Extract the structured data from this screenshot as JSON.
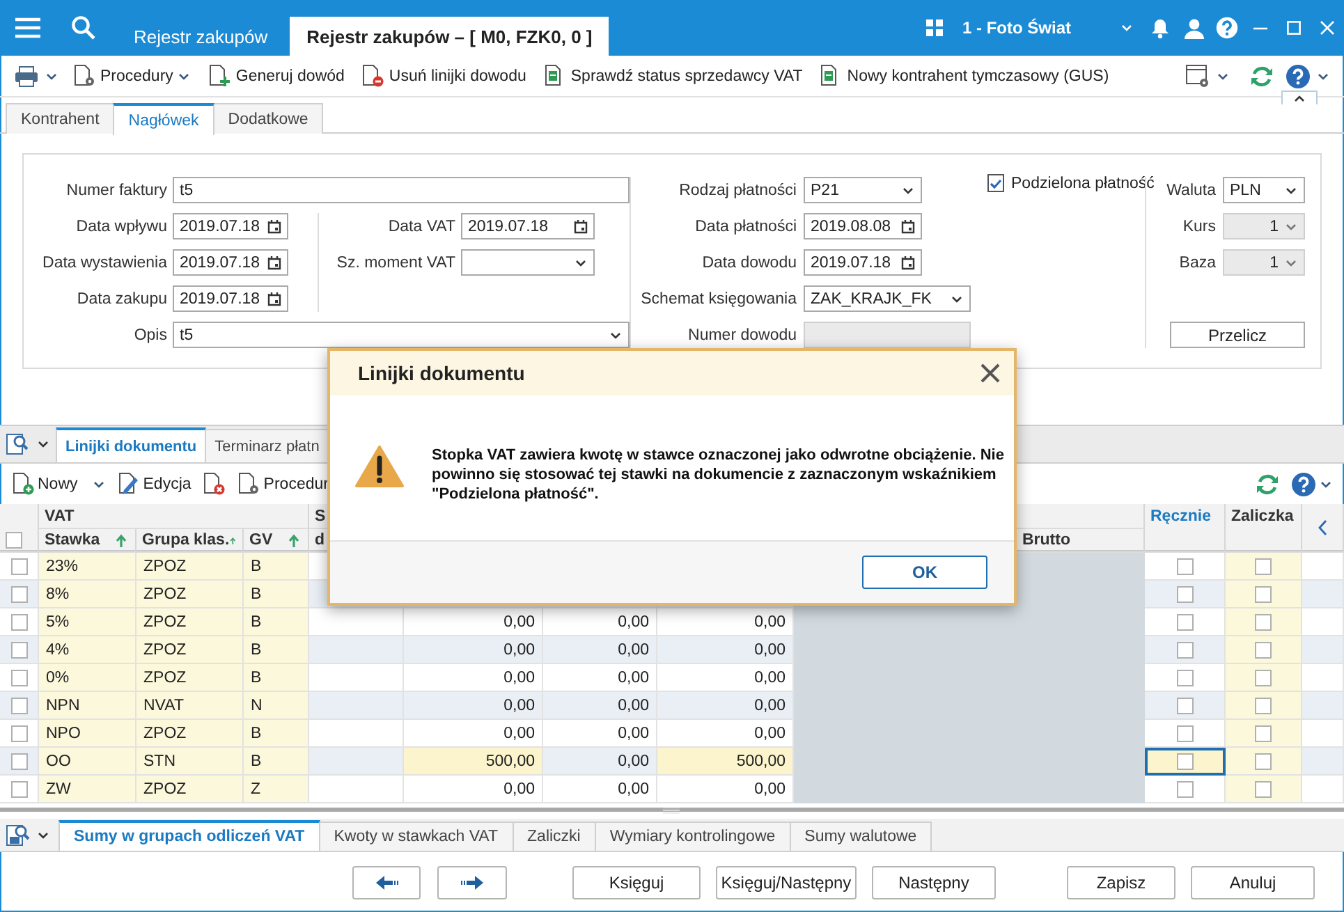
{
  "title_bar": {
    "tabs": [
      {
        "label": "Rejestr zakupów",
        "selected": false
      },
      {
        "label": "Rejestr zakupów – [ M0, FZK0, 0 ]",
        "selected": true
      }
    ],
    "company": "1 - Foto Świat"
  },
  "toolbar": {
    "items": [
      {
        "label": "Procedury",
        "dropdown": true
      },
      {
        "label": "Generuj dowód",
        "dropdown": false
      },
      {
        "label": "Usuń linijki dowodu",
        "dropdown": false
      },
      {
        "label": "Sprawdź status sprzedawcy VAT",
        "dropdown": false
      },
      {
        "label": "Nowy kontrahent tymczasowy (GUS)",
        "dropdown": false
      }
    ]
  },
  "tabs": [
    {
      "label": "Kontrahent",
      "selected": false
    },
    {
      "label": "Nagłówek",
      "selected": true
    },
    {
      "label": "Dodatkowe",
      "selected": false
    }
  ],
  "form": {
    "column_1": [
      {
        "label": "Numer faktury",
        "value": "t5",
        "kind": "text"
      },
      {
        "label": "Data wpływu",
        "value": "2019.07.18",
        "kind": "date"
      },
      {
        "label": "Data wystawienia",
        "value": "2019.07.18",
        "kind": "date"
      },
      {
        "label": "Data zakupu",
        "value": "2019.07.18",
        "kind": "date"
      },
      {
        "label": "Opis",
        "value": "t5",
        "kind": "select"
      }
    ],
    "column_1b": [
      {
        "label": "Data VAT",
        "value": "2019.07.18",
        "kind": "date"
      },
      {
        "label": "Sz. moment VAT",
        "kind": "select"
      }
    ],
    "column_2": [
      {
        "label": "Rodzaj płatności",
        "value": "P21",
        "kind": "select"
      },
      {
        "label": "Data płatności",
        "value": "2019.08.08",
        "kind": "date"
      },
      {
        "label": "Data dowodu",
        "value": "2019.07.18",
        "kind": "date"
      },
      {
        "label": "Schemat księgowania",
        "value": "ZAK_KRAJK_FK",
        "kind": "select"
      },
      {
        "label": "Numer dowodu",
        "kind": "text",
        "disabled": true
      }
    ],
    "split_payment": {
      "label": "Podzielona płatność",
      "checked": true
    },
    "column_3": [
      {
        "label": "Waluta",
        "value": "PLN",
        "kind": "select",
        "disabled": false
      },
      {
        "label": "Kurs",
        "value": "1",
        "kind": "select",
        "disabled": true
      },
      {
        "label": "Baza",
        "value": "1",
        "kind": "select",
        "disabled": true
      }
    ],
    "recalculate_button": "Przelicz"
  },
  "lines": {
    "tabs": [
      {
        "label": "Linijki dokumentu",
        "selected": true
      },
      {
        "label": "Terminarz płatn",
        "selected": false
      }
    ],
    "toolbar": [
      {
        "label": "Nowy",
        "dropdown": true
      },
      {
        "label": "Edycja",
        "dropdown": false
      },
      {
        "label": "Procedur",
        "dropdown": false
      }
    ]
  },
  "grid": {
    "group_headers": [
      "VAT",
      "S"
    ],
    "columns": [
      "Stawka",
      "Grupa klas.",
      "GV",
      "d",
      "Brutto"
    ],
    "manual_header": "Ręcznie",
    "advance_header": "Zaliczka",
    "header_checked": false,
    "rows": [
      {
        "checked": false,
        "rate": "23%",
        "group": "ZPOZ",
        "gv": "B",
        "manual": false,
        "advance": false,
        "selected": false
      },
      {
        "checked": false,
        "rate": "8%",
        "group": "ZPOZ",
        "gv": "B",
        "manual": false,
        "advance": false,
        "selected": false
      },
      {
        "checked": false,
        "rate": "5%",
        "group": "ZPOZ",
        "gv": "B",
        "amounts": [
          "0,00",
          "0,00",
          "0,00"
        ],
        "manual": false,
        "advance": false,
        "selected": false
      },
      {
        "checked": false,
        "rate": "4%",
        "group": "ZPOZ",
        "gv": "B",
        "amounts": [
          "0,00",
          "0,00",
          "0,00"
        ],
        "manual": false,
        "advance": false,
        "selected": false
      },
      {
        "checked": false,
        "rate": "0%",
        "group": "ZPOZ",
        "gv": "B",
        "amounts": [
          "0,00",
          "0,00",
          "0,00"
        ],
        "manual": false,
        "advance": false,
        "selected": false
      },
      {
        "checked": false,
        "rate": "NPN",
        "group": "NVAT",
        "gv": "N",
        "amounts": [
          "0,00",
          "0,00",
          "0,00"
        ],
        "manual": false,
        "advance": false,
        "selected": false
      },
      {
        "checked": false,
        "rate": "NPO",
        "group": "ZPOZ",
        "gv": "B",
        "amounts": [
          "0,00",
          "0,00",
          "0,00"
        ],
        "manual": false,
        "advance": false,
        "selected": false
      },
      {
        "checked": false,
        "rate": "OO",
        "group": "STN",
        "gv": "B",
        "amounts": [
          "500,00",
          "0,00",
          "500,00"
        ],
        "manual": false,
        "advance": false,
        "selected": true
      },
      {
        "checked": false,
        "rate": "ZW",
        "group": "ZPOZ",
        "gv": "Z",
        "amounts": [
          "0,00",
          "0,00",
          "0,00"
        ],
        "manual": false,
        "advance": false,
        "selected": false
      }
    ]
  },
  "bottom_tabs": [
    {
      "label": "Sumy w grupach odliczeń VAT",
      "selected": true
    },
    {
      "label": "Kwoty w stawkach VAT",
      "selected": false
    },
    {
      "label": "Zaliczki",
      "selected": false
    },
    {
      "label": "Wymiary kontrolingowe",
      "selected": false
    },
    {
      "label": "Sumy walutowe",
      "selected": false
    }
  ],
  "buttons": [
    "Księguj",
    "Księguj/Następny",
    "Następny",
    "Zapisz",
    "Anuluj"
  ],
  "dialog": {
    "title": "Linijki dokumentu",
    "message": "Stopka VAT zawiera kwotę w stawce oznaczonej jako odwrotne obciążenie. Nie powinno się stosować tej stawki na dokumencie z zaznaczonym wskaźnikiem \"Podzielona płatność\".",
    "ok_button": "OK"
  }
}
